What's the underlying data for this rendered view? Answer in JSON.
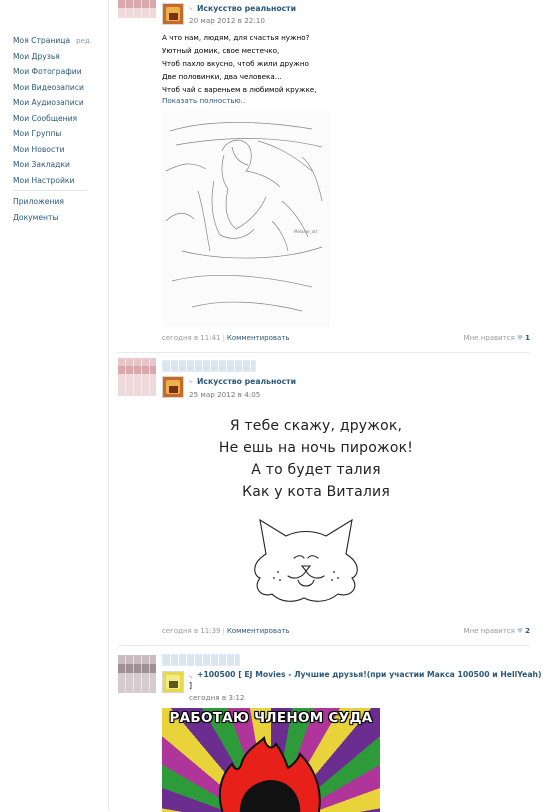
{
  "sidebar": {
    "items": [
      {
        "label": "Моя Страница",
        "extra": "ред."
      },
      {
        "label": "Мои Друзья"
      },
      {
        "label": "Мои Фотографии"
      },
      {
        "label": "Мои Видеозаписи"
      },
      {
        "label": "Мои Аудиозаписи"
      },
      {
        "label": "Мои Сообщения"
      },
      {
        "label": "Мои Группы"
      },
      {
        "label": "Мои Новости"
      },
      {
        "label": "Мои Закладки"
      },
      {
        "label": "Мои Настройки"
      }
    ],
    "extra_items": [
      {
        "label": "Приложения"
      },
      {
        "label": "Документы"
      }
    ]
  },
  "posts": [
    {
      "source": "Искусство реальности",
      "date": "20 мар 2012 в 22:10",
      "text_lines": [
        "А что нам, людям, для счастья нужно?",
        "Уютный домик, свое местечко,",
        "Чтоб пахло вкусно, чтоб жили дружно",
        "Две половинки, два человека...",
        "Чтоб чай с вареньем в любимой кружке,"
      ],
      "show_more": "Показать полностью..",
      "image_caption": "Melanie_art",
      "footer_time": "сегодня в 11:41",
      "footer_comment": "Комментировать",
      "like_label": "Мне нравится",
      "like_count": "1"
    },
    {
      "source": "Искусство реальности",
      "date": "25 мар 2012 в 4:05",
      "image_lines": [
        "Я тебе скажу, дружок,",
        "Не ешь на ночь пирожок!",
        "А то будет талия",
        "Как у кота Виталия"
      ],
      "footer_time": "сегодня в 11:39",
      "footer_comment": "Комментировать",
      "like_label": "Мне нравится",
      "like_count": "2"
    },
    {
      "source": "+100500 [ EJ Movies - Лучшие друзья!(при участии Макса 100500 и HellYeah)",
      "source_tail": "]",
      "date": "сегодня в 3:12",
      "meme_title": "РАБОТАЮ ЧЛЕНОМ СУДА"
    }
  ],
  "icons": {
    "repost": "repost-arrow-icon",
    "like": "heart-icon"
  },
  "colors": {
    "link": "#2b587a",
    "muted": "#999999",
    "divider": "#e6eaee"
  }
}
